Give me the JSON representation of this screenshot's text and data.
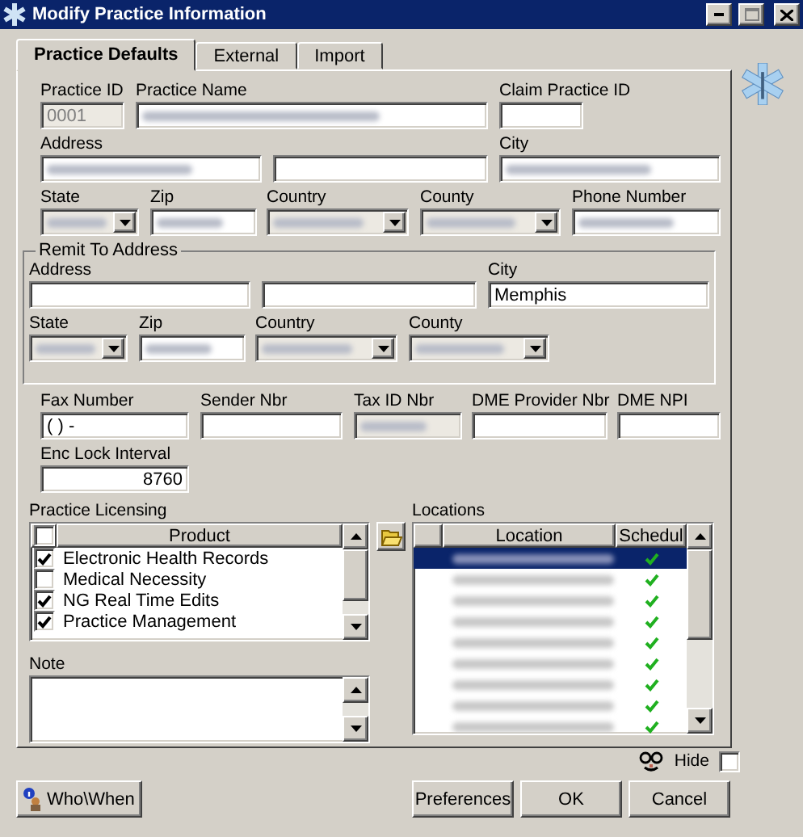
{
  "window": {
    "title": "Modify Practice Information"
  },
  "tabs": [
    {
      "label": "Practice Defaults",
      "selected": true
    },
    {
      "label": "External",
      "selected": false
    },
    {
      "label": "Import",
      "selected": false
    }
  ],
  "rows": [
    [
      {
        "label": "Practice ID",
        "value": "0001",
        "kind": "text",
        "disabled": true,
        "blurred": false
      },
      {
        "label": "Practice Name",
        "kind": "text",
        "disabled": false,
        "blurred": true
      },
      {
        "label": "Claim Practice ID",
        "kind": "text",
        "disabled": false,
        "blurred": false
      }
    ],
    [
      {
        "label": "Address",
        "kind": "text",
        "disabled": false,
        "blurred": true
      },
      {
        "kind": "text",
        "disabled": false,
        "blurred": false
      },
      {
        "label": "City",
        "kind": "text",
        "disabled": false,
        "blurred": true
      }
    ],
    [
      {
        "label": "State",
        "kind": "combo",
        "disabled": true,
        "blurred": true
      },
      {
        "label": "Zip",
        "kind": "text",
        "disabled": false,
        "blurred": true
      },
      {
        "label": "Country",
        "kind": "combo",
        "disabled": true,
        "blurred": true
      },
      {
        "label": "County",
        "kind": "combo",
        "disabled": true,
        "blurred": true
      },
      {
        "label": "Phone Number",
        "kind": "text",
        "disabled": false,
        "blurred": true
      }
    ]
  ],
  "remit": {
    "title": "Remit To Address",
    "rows": [
      [
        {
          "label": "Address",
          "kind": "text",
          "disabled": false,
          "blurred": false
        },
        {
          "kind": "text",
          "disabled": false,
          "blurred": false
        },
        {
          "label": "City",
          "value": "Memphis",
          "kind": "text",
          "disabled": false,
          "blurred": false
        }
      ],
      [
        {
          "label": "State",
          "kind": "combo",
          "disabled": true,
          "blurred": true
        },
        {
          "label": "Zip",
          "kind": "text",
          "disabled": false,
          "blurred": true
        },
        {
          "label": "Country",
          "kind": "combo",
          "disabled": true,
          "blurred": true
        },
        {
          "label": "County",
          "kind": "combo",
          "disabled": true,
          "blurred": true
        }
      ]
    ]
  },
  "rows_after": [
    [
      {
        "label": "Fax Number",
        "value": "(  )    -",
        "kind": "text",
        "disabled": false,
        "blurred": false
      },
      {
        "label": "Sender Nbr",
        "kind": "text",
        "disabled": false,
        "blurred": false
      },
      {
        "label": "Tax ID Nbr",
        "kind": "text",
        "disabled": true,
        "blurred": true
      },
      {
        "label": "DME Provider Nbr",
        "kind": "text",
        "disabled": false,
        "blurred": false
      },
      {
        "label": "DME NPI",
        "kind": "text",
        "disabled": false,
        "blurred": false
      }
    ],
    [
      {
        "label": "Enc Lock Interval",
        "value": "8760",
        "kind": "number",
        "disabled": false,
        "blurred": false
      }
    ]
  ],
  "licensing": {
    "label": "Practice Licensing",
    "header_checked": false,
    "column": "Product",
    "rows": [
      {
        "name": "Electronic Health Records",
        "checked": true
      },
      {
        "name": "Medical Necessity",
        "checked": false
      },
      {
        "name": "NG Real Time Edits",
        "checked": true
      },
      {
        "name": "Practice Management",
        "checked": true
      }
    ]
  },
  "note": {
    "label": "Note"
  },
  "locations": {
    "label": "Locations",
    "columns": [
      "Location",
      "Schedul"
    ],
    "rows": [
      {
        "selected": true,
        "scheduled": true
      },
      {
        "selected": false,
        "scheduled": true
      },
      {
        "selected": false,
        "scheduled": true
      },
      {
        "selected": false,
        "scheduled": true
      },
      {
        "selected": false,
        "scheduled": true
      },
      {
        "selected": false,
        "scheduled": true
      },
      {
        "selected": false,
        "scheduled": true
      },
      {
        "selected": false,
        "scheduled": true
      },
      {
        "selected": false,
        "scheduled": true
      }
    ]
  },
  "hide": {
    "label": "Hide",
    "checked": false
  },
  "buttons": {
    "who_when": "Who\\When",
    "actions": [
      "Preferences",
      "OK",
      "Cancel"
    ]
  }
}
